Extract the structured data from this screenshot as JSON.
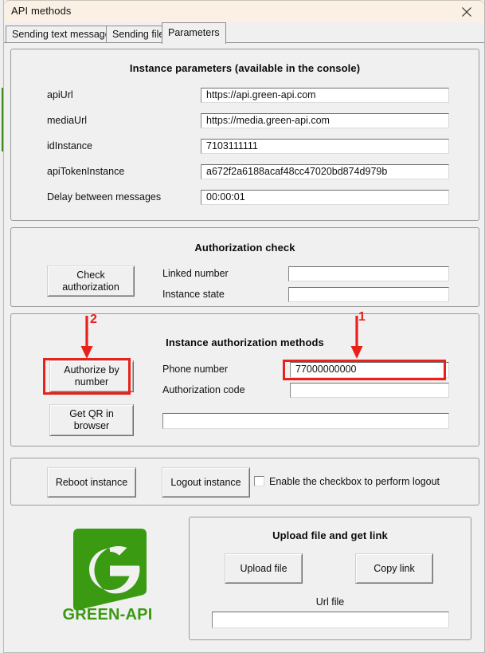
{
  "window": {
    "title": "API methods",
    "close_icon": "close-icon"
  },
  "tabs": [
    {
      "label": "Sending text messages",
      "selected": false
    },
    {
      "label": "Sending files",
      "selected": false
    },
    {
      "label": "Parameters",
      "selected": true
    }
  ],
  "instance_parameters": {
    "title": "Instance parameters (available in the console)",
    "fields": [
      {
        "label": "apiUrl",
        "value": "https://api.green-api.com"
      },
      {
        "label": "mediaUrl",
        "value": "https://media.green-api.com"
      },
      {
        "label": "idInstance",
        "value": "7103111111"
      },
      {
        "label": "apiTokenInstance",
        "value": "a672f2a6188acaf48cc47020bd874d979b"
      },
      {
        "label": "Delay between messages",
        "value": "00:00:01"
      }
    ]
  },
  "authorization_check": {
    "title": "Authorization check",
    "button_label": "Check\nauthorization",
    "fields": [
      {
        "label": "Linked number",
        "value": ""
      },
      {
        "label": "Instance state",
        "value": ""
      }
    ]
  },
  "authorization_methods": {
    "title": "Instance authorization methods",
    "authorize_button_label": "Authorize by\nnumber",
    "qr_button_label": "Get QR in\nbrowser",
    "fields": [
      {
        "label": "Phone number",
        "value": "77000000000"
      },
      {
        "label": "Authorization code",
        "value": ""
      }
    ],
    "qr_result_value": ""
  },
  "instance_actions": {
    "reboot_label": "Reboot instance",
    "logout_label": "Logout instance",
    "checkbox_label": "Enable the checkbox to perform logout",
    "checkbox_checked": false
  },
  "upload_panel": {
    "title": "Upload file and get link",
    "upload_label": "Upload file",
    "copy_label": "Copy link",
    "url_label": "Url file",
    "url_value": ""
  },
  "branding": {
    "logo_text": "GREEN-API",
    "logo_letter": "G",
    "logo_color": "#3a9a12"
  },
  "annotations": [
    {
      "number": "1",
      "target": "phone-number-input"
    },
    {
      "number": "2",
      "target": "authorize-by-number-button"
    }
  ]
}
